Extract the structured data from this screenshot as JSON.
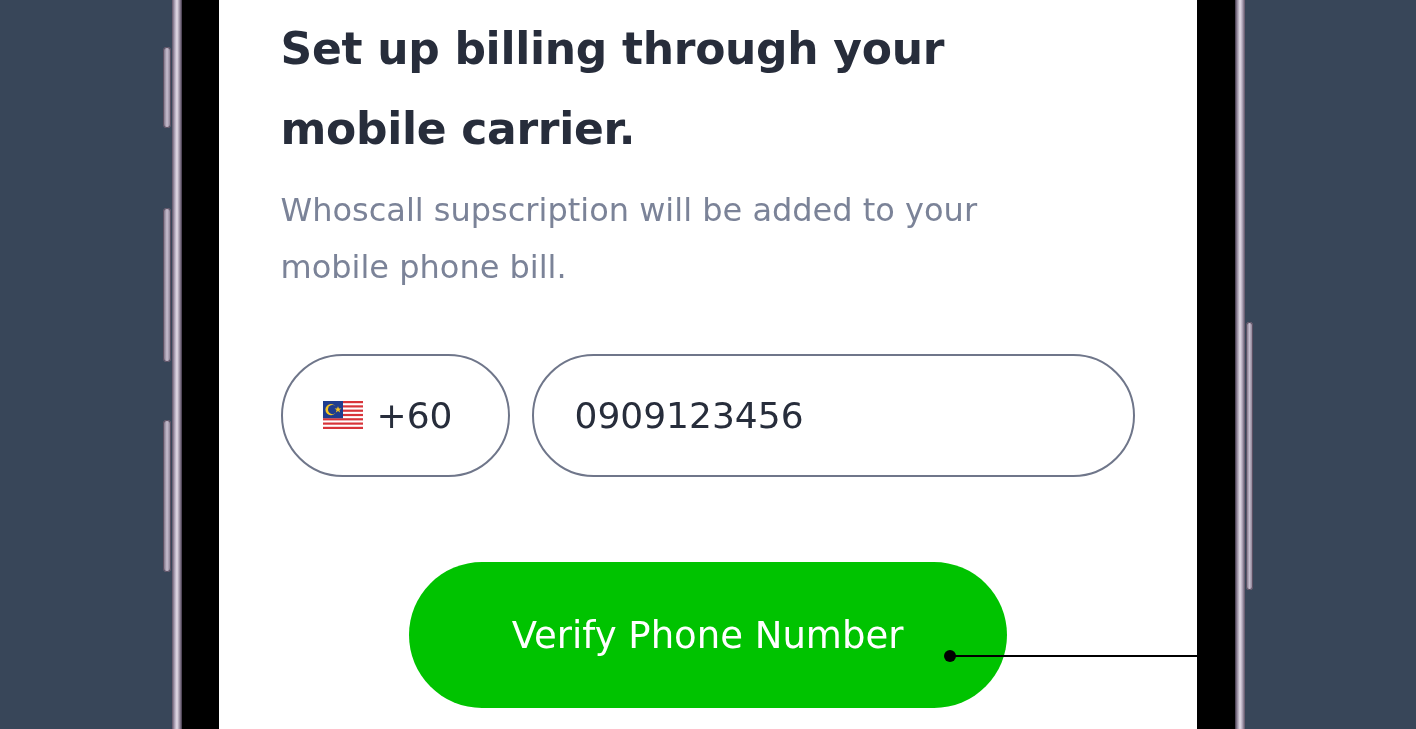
{
  "heading": "Set up billing through your mobile carrier.",
  "description": "Whoscall supscription will be added to your mobile phone bill.",
  "country_code": {
    "value": "+60"
  },
  "phone_number": {
    "value": "0909123456"
  },
  "verify_button": {
    "label": "Verify Phone Number"
  }
}
